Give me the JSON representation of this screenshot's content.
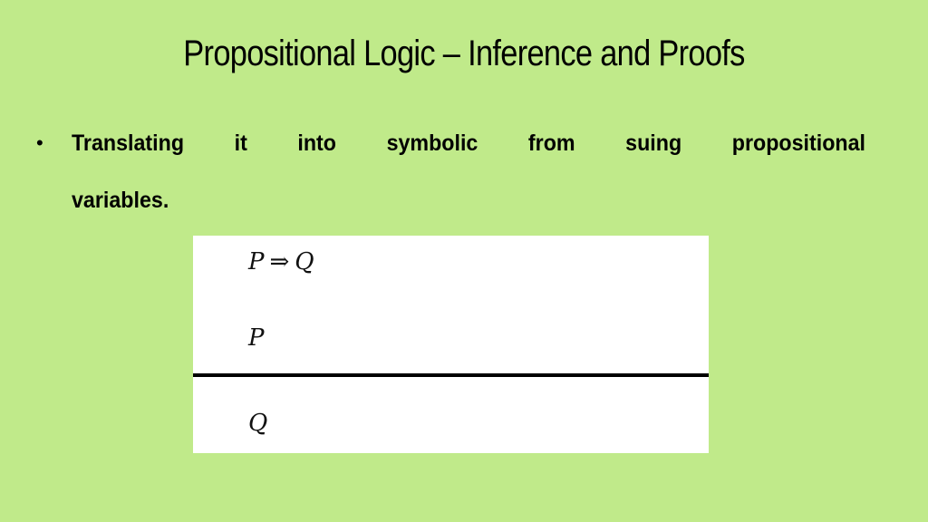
{
  "slide": {
    "title": "Propositional Logic – Inference and Proofs",
    "background_color": "#c0ea8a",
    "bullets": [
      {
        "marker": "•",
        "line1_words": [
          "Translating",
          "it",
          "into",
          "symbolic",
          "from",
          "suing",
          "propositional"
        ],
        "line2": "variables."
      }
    ],
    "proof": {
      "premises": [
        {
          "left": "P",
          "operator": "⇒",
          "right": "Q"
        },
        {
          "left": "P"
        }
      ],
      "conclusion": {
        "left": "Q"
      },
      "operator_icon": "implies-arrow-icon"
    }
  }
}
